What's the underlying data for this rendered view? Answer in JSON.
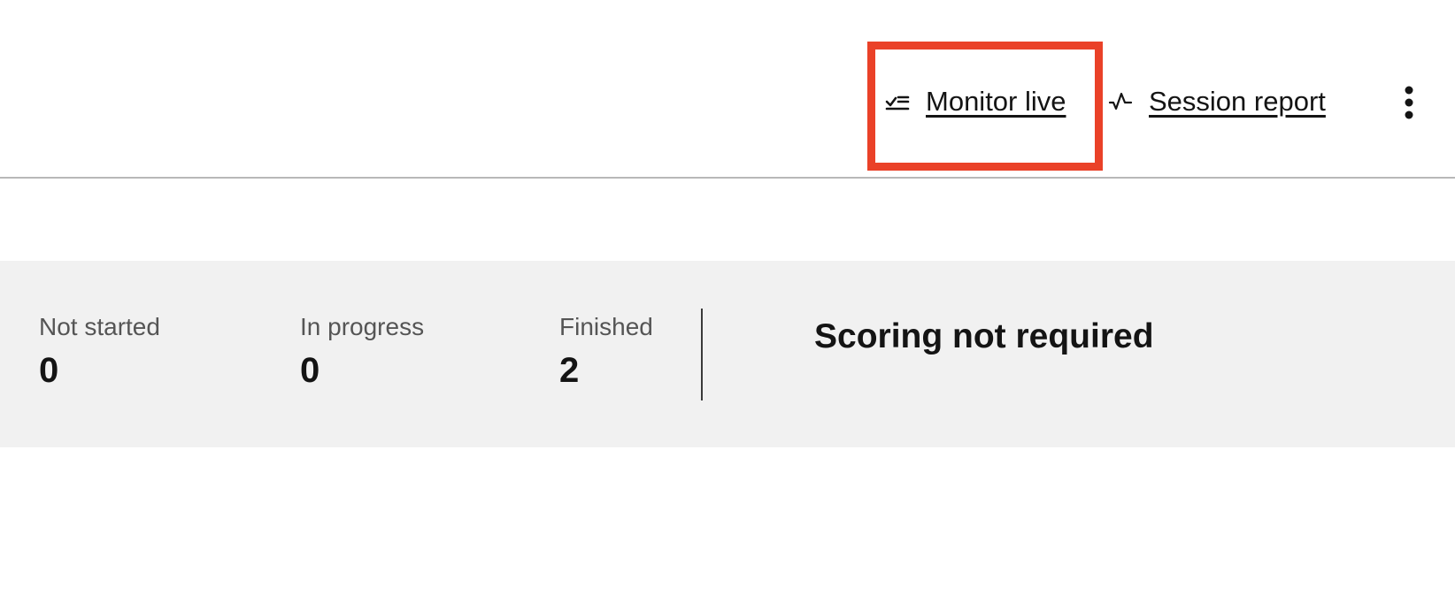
{
  "header": {
    "actions": [
      {
        "label": "Monitor live",
        "icon": "checklist-icon"
      },
      {
        "label": "Session report",
        "icon": "activity-icon"
      }
    ],
    "more_menu_icon": "more-vertical-icon",
    "highlight_color": "#ea4128"
  },
  "summary": {
    "stats": [
      {
        "label": "Not started",
        "value": "0"
      },
      {
        "label": "In progress",
        "value": "0"
      },
      {
        "label": "Finished",
        "value": "2"
      }
    ],
    "scoring_status": "Scoring not required"
  },
  "colors": {
    "text": "#141414",
    "muted_text": "#555555",
    "band_background": "#f1f1f1",
    "rule": "#b8b8b8"
  }
}
